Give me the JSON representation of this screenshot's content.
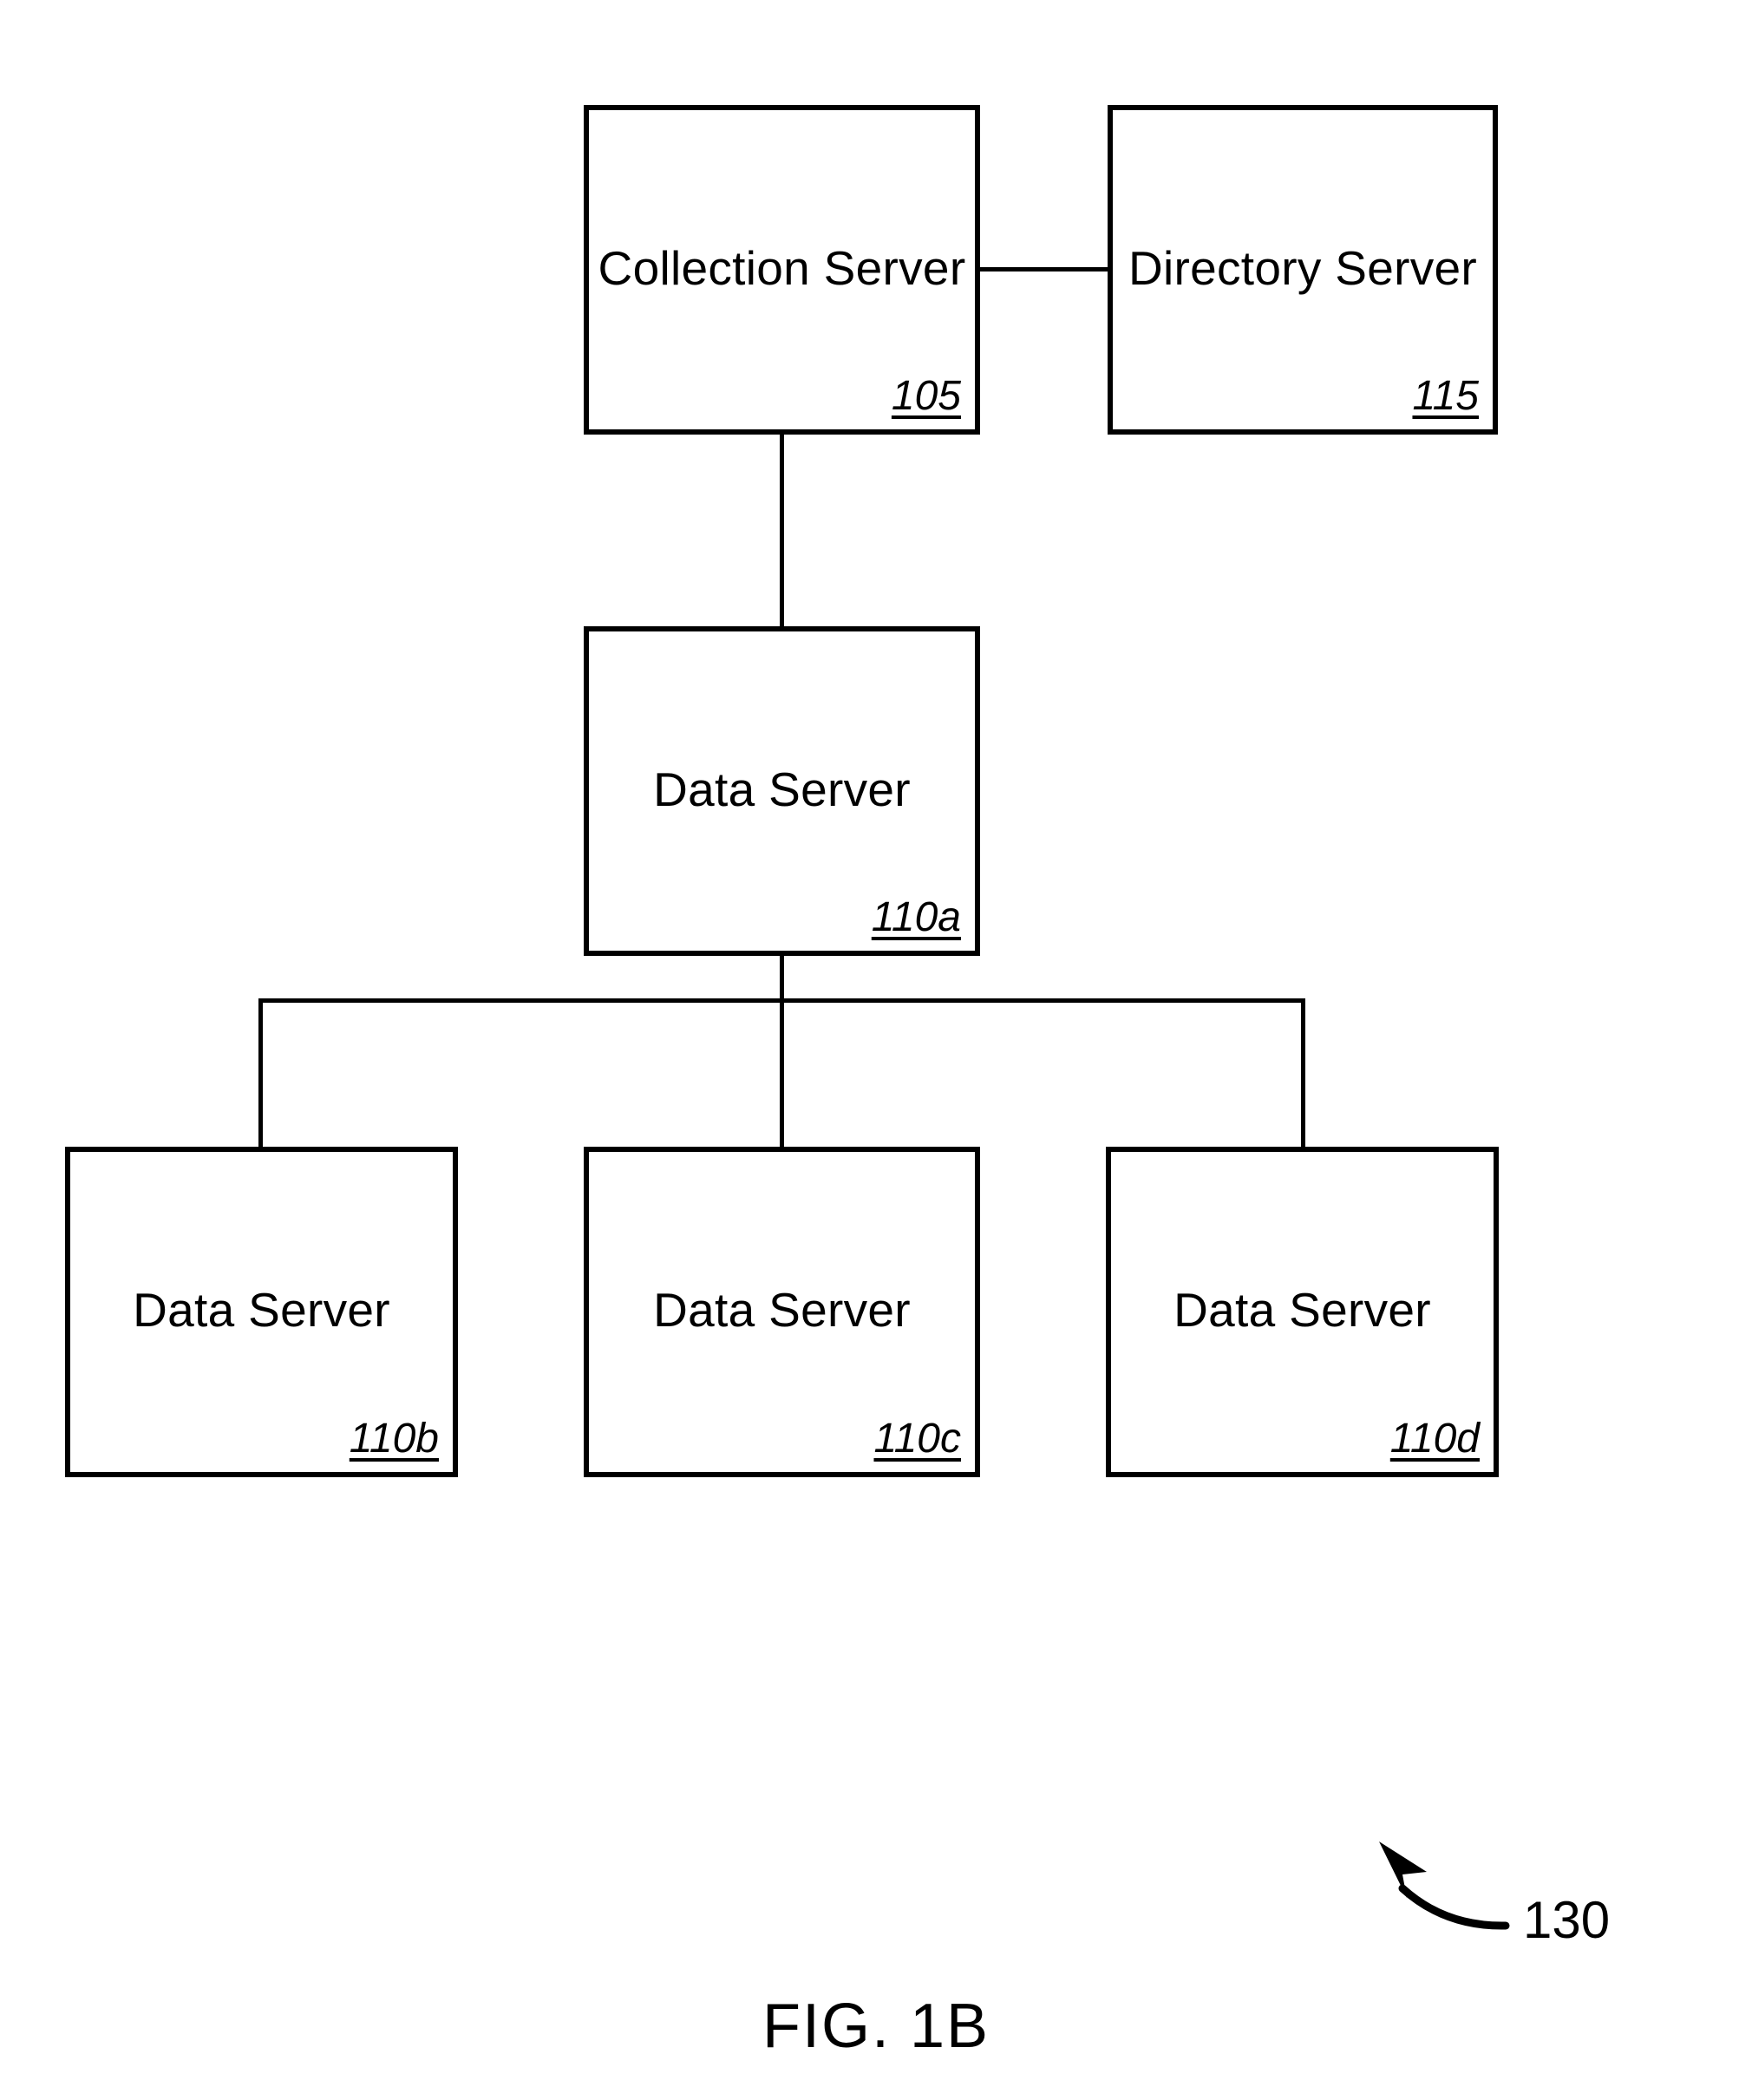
{
  "figure": {
    "caption": "FIG. 1B",
    "callout_number": "130",
    "stroke_color": "#000000",
    "background_color": "#ffffff"
  },
  "nodes": [
    {
      "id": "collection-server",
      "label": "Collection Server",
      "ref": "105"
    },
    {
      "id": "directory-server",
      "label": "Directory Server",
      "ref": "115"
    },
    {
      "id": "data-server-a",
      "label": "Data Server",
      "ref": "110a"
    },
    {
      "id": "data-server-b",
      "label": "Data Server",
      "ref": "110b"
    },
    {
      "id": "data-server-c",
      "label": "Data Server",
      "ref": "110c"
    },
    {
      "id": "data-server-d",
      "label": "Data Server",
      "ref": "110d"
    }
  ],
  "connections": [
    {
      "from": "collection-server",
      "to": "directory-server"
    },
    {
      "from": "collection-server",
      "to": "data-server-a"
    },
    {
      "from": "data-server-a",
      "to": "data-server-b"
    },
    {
      "from": "data-server-a",
      "to": "data-server-c"
    },
    {
      "from": "data-server-a",
      "to": "data-server-d"
    }
  ]
}
